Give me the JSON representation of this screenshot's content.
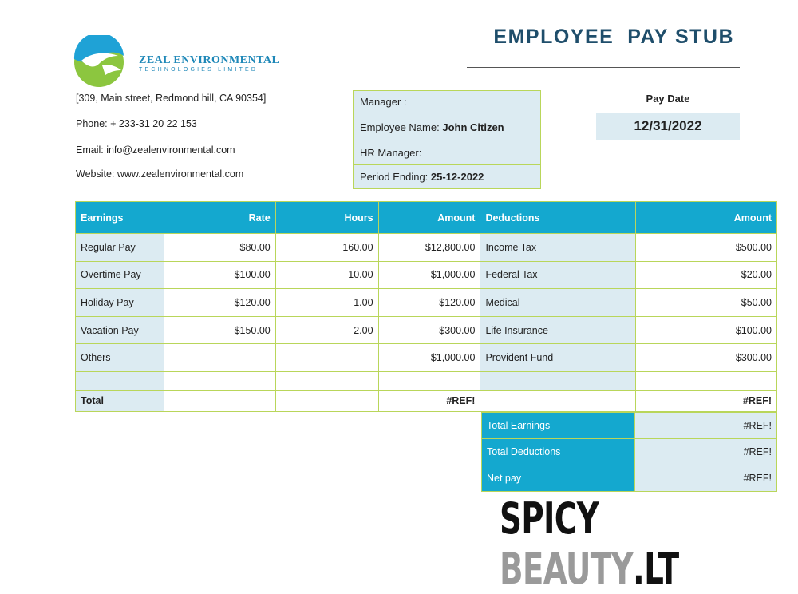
{
  "company": {
    "name": "ZEAL ENVIRONMENTAL",
    "tagline": "TECHNOLOGIES LIMITED",
    "address": "[309, Main street, Redmond hill, CA 90354]",
    "phone": "Phone: + 233-31 20 22 153",
    "email": "Email: info@zealenvironmental.com",
    "website": "Website: www.zealenvironmental.com"
  },
  "title": "EMPLOYEE  PAY STUB",
  "manager_box": {
    "manager_label": "Manager :",
    "employee_label": "Employee Name:",
    "employee_value": "John Citizen",
    "hr_label": "HR Manager:",
    "period_label": "Period Ending:",
    "period_value": "25-12-2022"
  },
  "pay_date": {
    "label": "Pay Date",
    "value": "12/31/2022"
  },
  "table": {
    "headers": [
      "Earnings",
      "Rate",
      "Hours",
      "Amount",
      "Deductions",
      "Amount"
    ],
    "rows": [
      [
        "Regular Pay",
        "$80.00",
        "160.00",
        "$12,800.00",
        "Income Tax",
        "$500.00"
      ],
      [
        "Overtime Pay",
        "$100.00",
        "10.00",
        "$1,000.00",
        "Federal Tax",
        "$20.00"
      ],
      [
        "Holiday Pay",
        "$120.00",
        "1.00",
        "$120.00",
        "Medical",
        "$50.00"
      ],
      [
        "Vacation Pay",
        "$150.00",
        "2.00",
        "$300.00",
        "Life Insurance",
        "$100.00"
      ],
      [
        "Others",
        "",
        "",
        "$1,000.00",
        "Provident Fund",
        "$300.00"
      ],
      [
        "",
        "",
        "",
        "",
        "",
        ""
      ]
    ],
    "total": [
      "Total",
      "",
      "",
      "#REF!",
      "",
      "#REF!"
    ]
  },
  "summary": [
    {
      "label": "Total Earnings",
      "value": "#REF!"
    },
    {
      "label": "Total Deductions",
      "value": "#REF!"
    },
    {
      "label": "Net pay",
      "value": "#REF!"
    }
  ],
  "watermark": {
    "part1": "SPICY",
    "part2": "BEAUTY",
    "part3": ".LT"
  },
  "colors": {
    "header_blue": "#14a8cf",
    "cell_shade": "#dcebf2",
    "border_green": "#b9d65a",
    "title_navy": "#1f4e6b",
    "logo_green": "#8cc63f",
    "logo_blue": "#1fa2d6"
  }
}
